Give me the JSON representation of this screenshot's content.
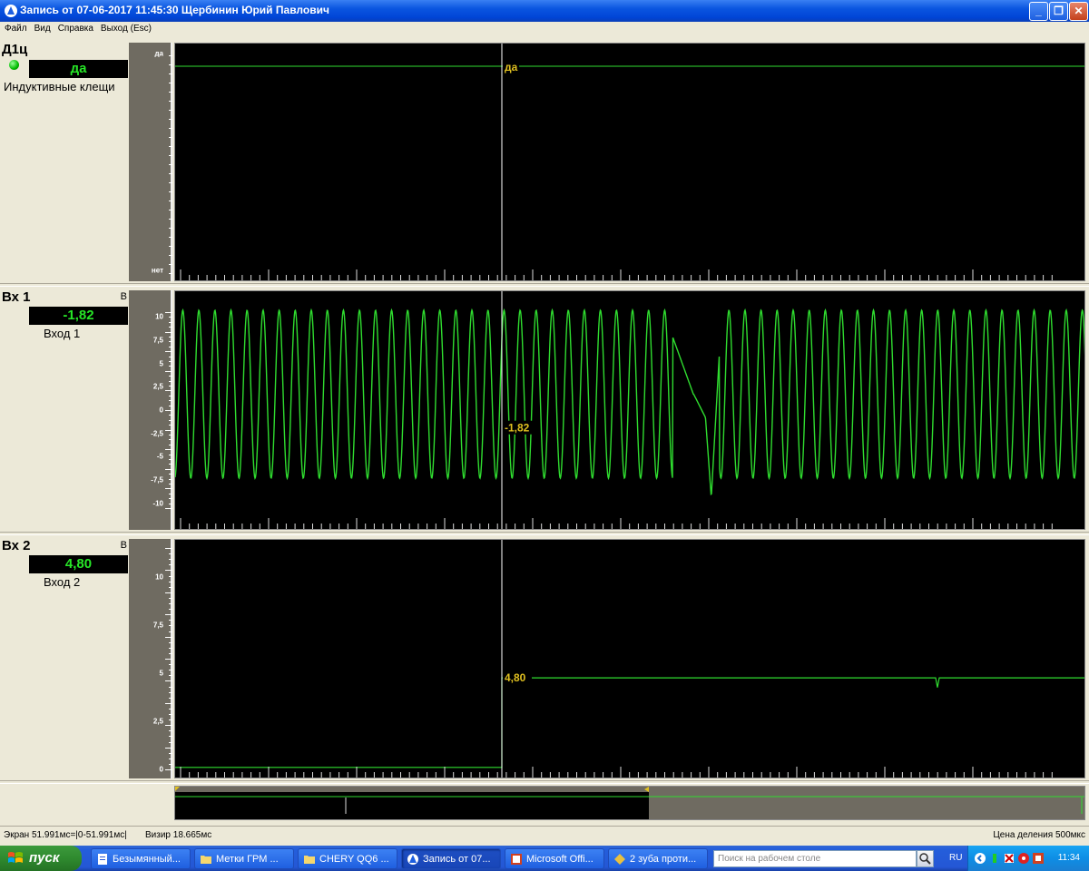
{
  "window": {
    "title": "Запись от 07-06-2017 11:45:30 Щербинин Юрий Павлович",
    "buttons": {
      "minimize": "_",
      "restore": "❐",
      "close": "✕"
    }
  },
  "menu": [
    "Файл",
    "Вид",
    "Справка",
    "Выход (Esc)"
  ],
  "channels": {
    "d1c": {
      "name": "Д1ц",
      "value": "да",
      "description": "Индуктивные клещи",
      "scale_top": "да",
      "scale_bottom": "нет",
      "cursor_label": "да"
    },
    "in1": {
      "name": "Вх 1",
      "unit": "В",
      "value": "-1,82",
      "description": "Вход 1",
      "scale_labels": [
        "10",
        "7,5",
        "5",
        "2,5",
        "0",
        "-2,5",
        "-5",
        "-7,5",
        "-10"
      ],
      "cursor_label": "-1,82"
    },
    "in2": {
      "name": "Вх 2",
      "unit": "В",
      "value": "4,80",
      "description": "Вход 2",
      "scale_labels": [
        "10",
        "7,5",
        "5",
        "2,5",
        "0"
      ],
      "cursor_label": "4,80"
    }
  },
  "status": {
    "screen": "Экран 51.991мс=|0-51.991мс|",
    "visir": "Визир 18.665мс",
    "division": "Цена деления 500мкс"
  },
  "taskbar": {
    "start": "пуск",
    "tasks": [
      "Безымянный...",
      "Метки ГРМ ...",
      "CHERY QQ6 ...",
      "Запись от 07...",
      "Microsoft Offi...",
      "2 зуба проти..."
    ],
    "search_placeholder": "Поиск на рабочем столе",
    "language": "RU",
    "clock": "11:34"
  },
  "colors": {
    "trace": "#2fdc2f",
    "cursor": "#ffffff",
    "cursor_label": "#e0c020",
    "plot_bg": "#000000",
    "scale_bg": "#6f6b61"
  }
}
